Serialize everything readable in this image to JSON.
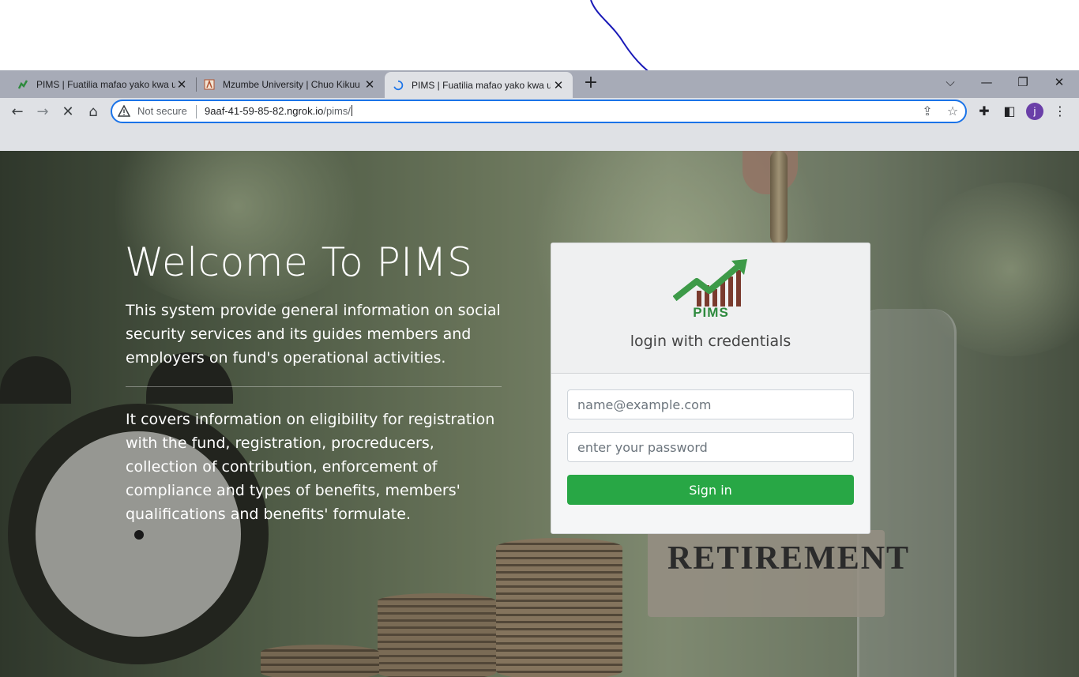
{
  "browser": {
    "tabs": [
      {
        "title": "PIMS | Fuatilia mafao yako kwa urahisi",
        "active": false
      },
      {
        "title": "Mzumbe University | Chuo Kikuu Mzumbe",
        "active": false
      },
      {
        "title": "PIMS | Fuatilia mafao yako kwa urahisi",
        "active": true
      }
    ],
    "new_tab_icon": "plus-icon",
    "security_label": "Not secure",
    "url_host": "9aaf-41-59-85-82.ngrok.io",
    "url_path": "/pims/",
    "profile_initial": "j",
    "colors": {
      "omnibox_focus": "#1a73e8",
      "avatar": "#6a3fa8"
    }
  },
  "page": {
    "title": "Welcome To PIMS",
    "intro": "This system provide general information on social security services and its guides members and employers on fund's operational activities.",
    "coverage": "It covers information on eligibility for registration with the fund, registration, procreducers, collection of contribution, enforcement of compliance and types of benefits, members' qualifications and benefits' formulate.",
    "background_sign": "RETIREMENT"
  },
  "login": {
    "logo_text": "PIMS",
    "subtitle": "login with credentials",
    "email_placeholder": "name@example.com",
    "password_placeholder": "enter your password",
    "submit_label": "Sign in",
    "colors": {
      "submit": "#28a745",
      "logo": "#2e8a3e"
    }
  }
}
